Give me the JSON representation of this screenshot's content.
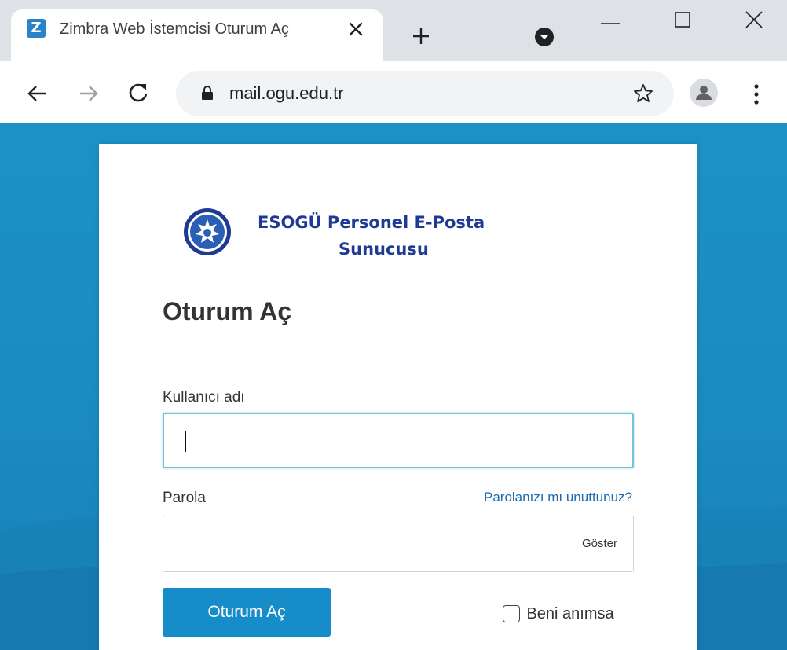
{
  "browser": {
    "tab": {
      "favicon_letter": "Z",
      "title": "Zimbra Web İstemcisi Oturum Aç"
    },
    "address_bar": {
      "url": "mail.ogu.edu.tr"
    }
  },
  "login": {
    "brand_line1": "ESOGÜ Personel E-Posta",
    "brand_line2": "Sunucusu",
    "title": "Oturum Aç",
    "username_label": "Kullanıcı adı",
    "username_value": "",
    "password_label": "Parola",
    "forgot_link": "Parolanızı mı unuttunuz?",
    "show_toggle": "Göster",
    "submit_label": "Oturum Aç",
    "remember_label": "Beni anımsa",
    "remember_checked": false
  },
  "colors": {
    "accent": "#168dc8",
    "brand_text": "#1f3a93",
    "link": "#1c6bb0",
    "focus_border": "#77c0de"
  }
}
